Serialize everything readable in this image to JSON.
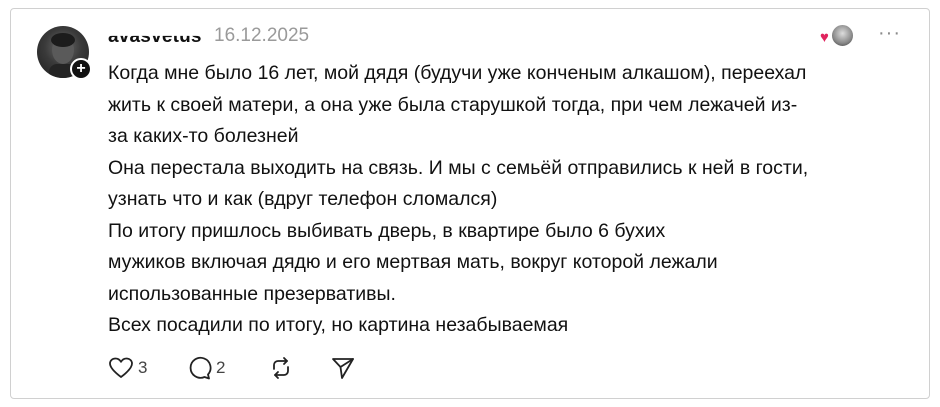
{
  "post": {
    "username": "avasvetus",
    "date": "16.12.2025",
    "menu_icon": "more-dots-icon",
    "follow_symbol": "+",
    "lines": [
      "Когда мне было 16 лет, мой дядя (будучи уже конченым алкашом), переехал",
      "жить к своей матери, а она уже была старушкой тогда, при чем лежачей из-",
      "за каких-то болезней",
      "Она перестала выходить на связь. И мы с семьёй отправились к ней в гости,",
      "узнать что и как (вдруг телефон сломался)",
      "По итогу пришлось выбивать дверь, в квартире было 6 бухих",
      "мужиков включая дядю и его мертвая мать, вокруг которой лежали",
      "использованные презервативы.",
      "Всех посадили по итогу, но картина незабываемая"
    ]
  },
  "actions": {
    "likes": "3",
    "replies": "2",
    "like_icon": "heart-icon",
    "reply_icon": "comment-bubble-icon",
    "repost_icon": "repost-icon",
    "share_icon": "send-icon"
  },
  "colors": {
    "text": "#111111",
    "muted": "#9a9a9a",
    "like_heart": "#e0245e"
  }
}
